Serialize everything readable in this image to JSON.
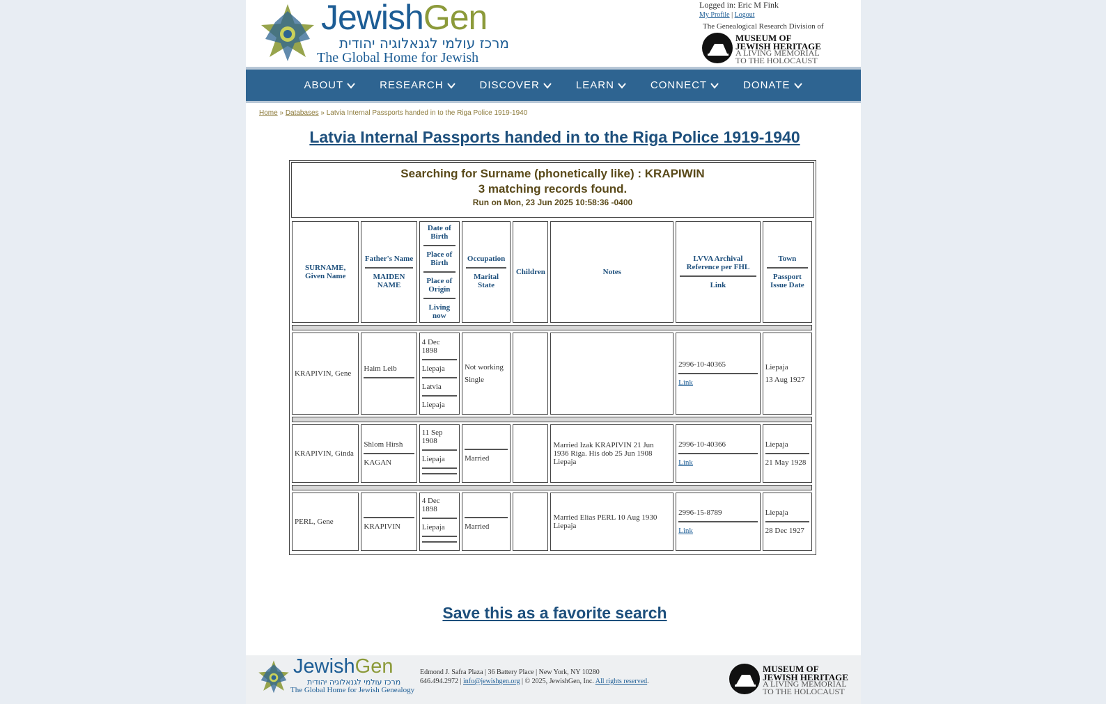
{
  "header": {
    "logo_word_a": "Jewish",
    "logo_word_b": "Gen",
    "logo_hebrew": "מרכז עולמי לגנאלוגיה יהודית",
    "logo_tagline": "The Global Home for Jewish Genealogy",
    "logged_in": "Logged in: Eric M Fink",
    "my_profile": "My Profile",
    "logout": "Logout",
    "link_separator": "|",
    "division_text": "The Genealogical Research Division of",
    "museum_name_1": "MUSEUM OF",
    "museum_name_2": "JEWISH HERITAGE",
    "museum_tag_1": "A LIVING MEMORIAL",
    "museum_tag_2": "TO THE HOLOCAUST"
  },
  "nav": {
    "items": [
      "ABOUT",
      "RESEARCH",
      "DISCOVER",
      "LEARN",
      "CONNECT",
      "DONATE"
    ]
  },
  "breadcrumb": {
    "home": "Home",
    "sep1": "»",
    "databases": "Databases",
    "sep2": "»",
    "current": "Latvia Internal Passports handed in to the Riga Police 1919-1940"
  },
  "page_title": "Latvia Internal Passports handed in to the Riga Police 1919-1940",
  "summary": {
    "search_line": "Searching for Surname (phonetically like) : KRAPIWIN",
    "count_line": "3 matching records found.",
    "run_line": "Run on Mon, 23 Jun 2025 10:58:36 -0400"
  },
  "table": {
    "headers": {
      "surname": "SURNAME, Given Name",
      "father": "Father's Name",
      "maiden": "MAIDEN NAME",
      "dob": "Date of Birth",
      "pob": "Place of Birth",
      "poo": "Place of Origin",
      "living": "Living now",
      "occupation": "Occupation",
      "marital": "Marital State",
      "children": "Children",
      "notes": "Notes",
      "lvva": "LVVA Archival Reference per FHL",
      "link": "Link",
      "town": "Town",
      "passport": "Passport Issue Date"
    },
    "rows": [
      {
        "name": "KRAPIVIN, Gene",
        "father": "Haim Leib",
        "maiden": "",
        "dob": "4 Dec 1898",
        "pob": "Liepaja",
        "poo": "Latvia",
        "living": "Liepaja",
        "occupation": "Not working",
        "marital": "Single",
        "children": "",
        "notes": "",
        "lvva": "2996-10-40365",
        "link": "Link",
        "town": "Liepaja",
        "passport": "13 Aug 1927"
      },
      {
        "name": "KRAPIVIN, Ginda",
        "father": "Shlom Hirsh",
        "maiden": "KAGAN",
        "dob": "11 Sep 1908",
        "pob": "Liepaja",
        "poo": "",
        "living": "",
        "occupation": "",
        "marital": "Married",
        "children": "",
        "notes": "Married Izak KRAPIVIN 21 Jun 1936 Riga. His dob 25 Jun 1908 Liepaja",
        "lvva": "2996-10-40366",
        "link": "Link",
        "town": "Liepaja",
        "passport": "21 May 1928"
      },
      {
        "name": "PERL, Gene",
        "father": "",
        "maiden": "KRAPIVIN",
        "dob": "4 Dec 1898",
        "pob": "Liepaja",
        "poo": "",
        "living": "",
        "occupation": "",
        "marital": "Married",
        "children": "",
        "notes": "Married Elias PERL 10 Aug 1930 Liepaja",
        "lvva": "2996-15-8789",
        "link": "Link",
        "town": "Liepaja",
        "passport": "28 Dec 1927"
      }
    ]
  },
  "save_link": "Save this as a favorite search",
  "footer": {
    "address": "Edmond J. Safra Plaza | 36 Battery Place | New York, NY 10280",
    "phone": "646.494.2972 |",
    "email": "info@jewishgen.org",
    "copyright": "| © 2025, JewishGen, Inc.",
    "rights": "All rights reserved",
    "period": "."
  },
  "colors": {
    "nav_bg": "#2e6491",
    "title_blue": "#1d4f7c",
    "brand_green": "#8c9a3a",
    "summary_brown": "#5a4a1a"
  }
}
